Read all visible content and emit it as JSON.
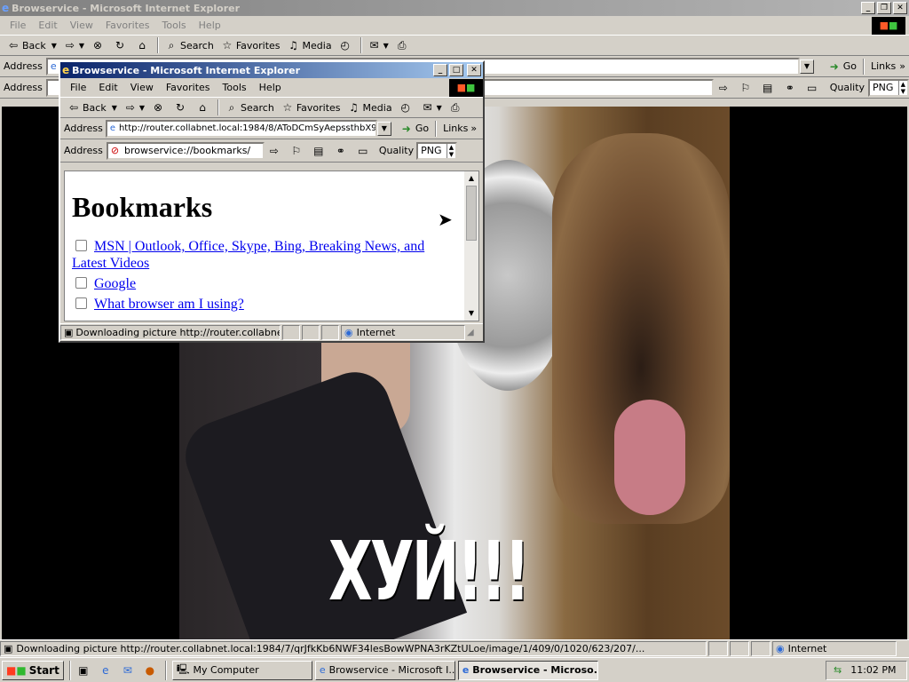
{
  "outer": {
    "title": "Browservice - Microsoft Internet Explorer",
    "menu": [
      "File",
      "Edit",
      "View",
      "Favorites",
      "Tools",
      "Help"
    ],
    "toolbar": {
      "back": "Back",
      "search": "Search",
      "favorites": "Favorites",
      "media": "Media"
    },
    "address_label": "Address",
    "go_label": "Go",
    "links_label": "Links",
    "inner_address_label": "Address",
    "quality_label": "Quality",
    "quality_value": "PNG",
    "status_text": "Downloading picture http://router.collabnet.local:1984/7/qrJfkKb6NWF34lesBowWPNA3rKZtULoe/image/1/409/0/1020/623/207/...",
    "zone": "Internet",
    "image_caption": "ХУЙ!!!"
  },
  "inner": {
    "title": "Browservice - Microsoft Internet Explorer",
    "menu": [
      "File",
      "Edit",
      "View",
      "Favorites",
      "Tools",
      "Help"
    ],
    "toolbar": {
      "back": "Back",
      "search": "Search",
      "favorites": "Favorites",
      "media": "Media"
    },
    "address_label": "Address",
    "address_value": "http://router.collabnet.local:1984/8/AToDCmSyAepssthbX9",
    "go_label": "Go",
    "links_label": "Links",
    "inner_address_label": "Address",
    "inner_address_value": "browservice://bookmarks/",
    "quality_label": "Quality",
    "quality_value": "PNG",
    "page_heading": "Bookmarks",
    "bookmarks": [
      "MSN | Outlook, Office, Skype, Bing, Breaking News, and Latest Videos",
      "Google",
      "What browser am I using?"
    ],
    "status_text": "Downloading picture http://router.collabnet.loc",
    "zone": "Internet"
  },
  "taskbar": {
    "start": "Start",
    "tasks": [
      "My Computer",
      "Browservice - Microsoft I...",
      "Browservice - Microso..."
    ],
    "clock": "11:02 PM"
  }
}
